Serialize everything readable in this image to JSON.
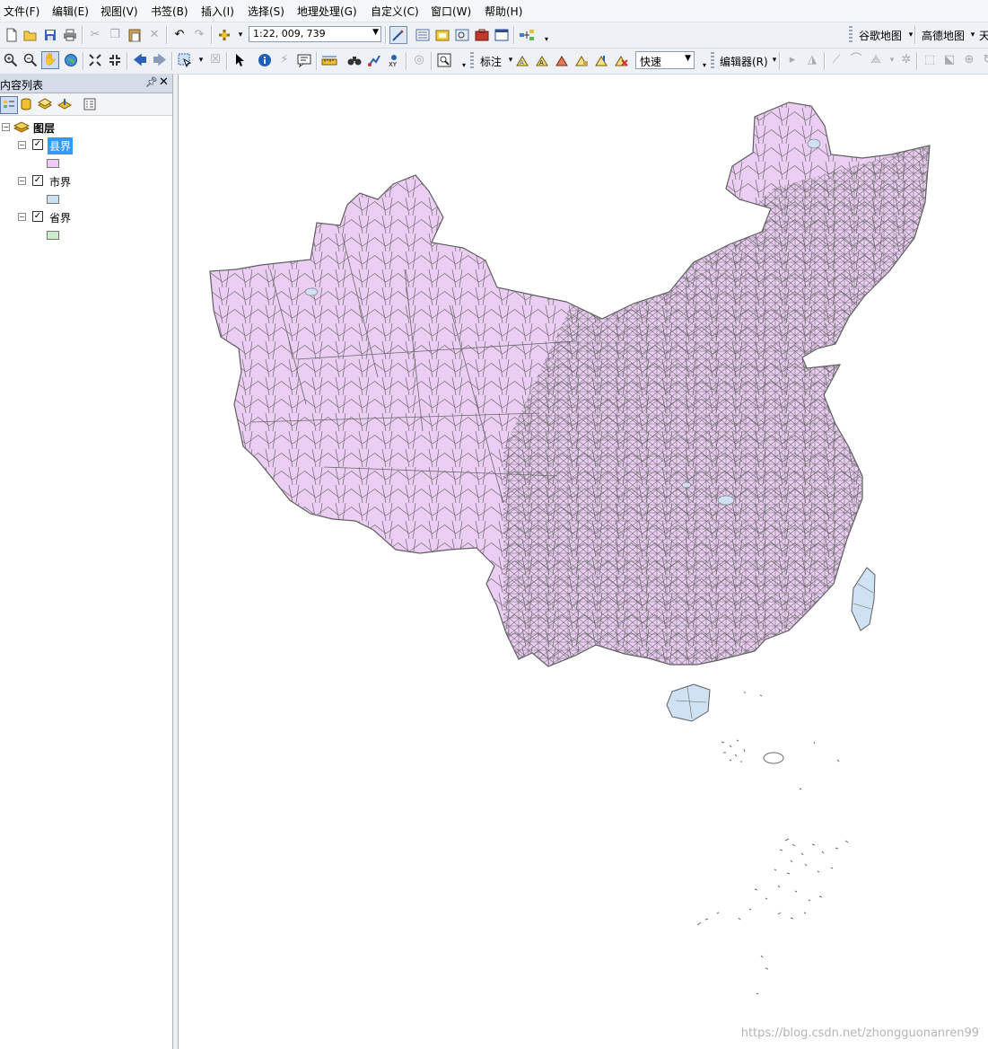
{
  "menu": [
    "文件(F)",
    "编辑(E)",
    "视图(V)",
    "书签(B)",
    "插入(I)",
    "选择(S)",
    "地理处理(G)",
    "自定义(C)",
    "窗口(W)",
    "帮助(H)"
  ],
  "toolbar": {
    "scale_value": "1:22, 009, 739",
    "basemap_google": "谷歌地图",
    "basemap_gaode": "高德地图",
    "basemap_tian": "天",
    "label_menu": "标注",
    "label_quality": "快速",
    "editor": "编辑器(R)"
  },
  "toc": {
    "title": "内容列表",
    "root": "图层",
    "layers": [
      {
        "name": "县界",
        "checked": true,
        "selected": true,
        "color": "#eecbf5"
      },
      {
        "name": "市界",
        "checked": true,
        "selected": false,
        "color": "#cce0f2"
      },
      {
        "name": "省界",
        "checked": true,
        "selected": false,
        "color": "#cdeccd"
      }
    ]
  },
  "map": {
    "county_fill": "#eccdf4",
    "city_fill": "#cfe2f3",
    "boundary_color": "#6a6a6a"
  },
  "watermark": "https://blog.csdn.net/zhongguonanren99"
}
